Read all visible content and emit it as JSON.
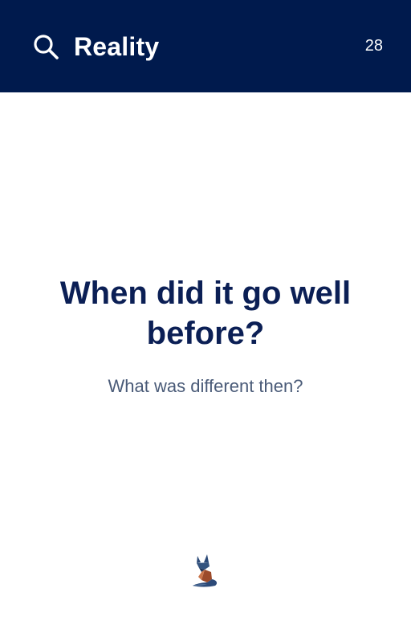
{
  "header": {
    "title": "Reality",
    "card_number": "28",
    "search_icon": "search-icon"
  },
  "content": {
    "question": "When did it go well before?",
    "subquestion": "What was different then?"
  },
  "footer": {
    "logo_icon": "fox-logo-icon"
  },
  "colors": {
    "header_background": "#001a4d",
    "question_text": "#0b1f55",
    "subquestion_text": "#4a5b78",
    "background": "#ffffff",
    "logo_blue": "#2c4a78",
    "logo_rust": "#9c4a2a"
  }
}
